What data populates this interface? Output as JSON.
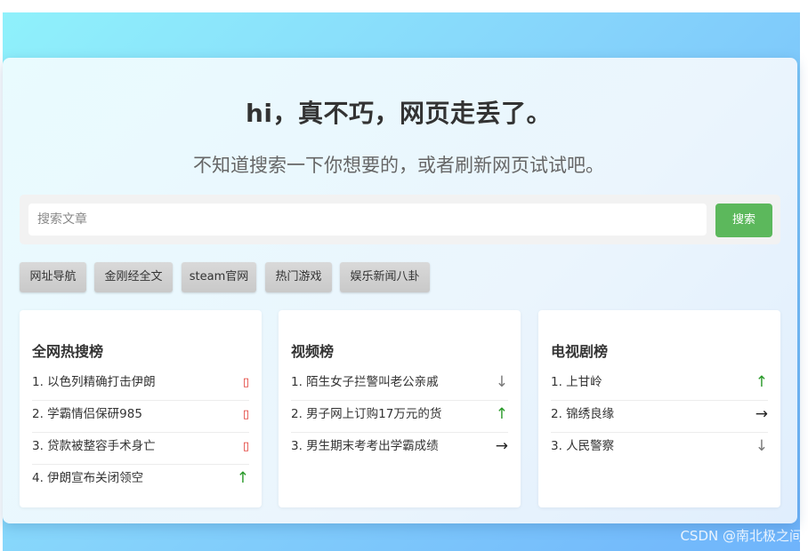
{
  "hero": {
    "title": "hi，真不巧，网页走丢了。",
    "subtitle": "不知道搜索一下你想要的，或者刷新网页试试吧。"
  },
  "search": {
    "placeholder": "搜索文章",
    "button_label": "搜索"
  },
  "tags": [
    {
      "label": "网址导航"
    },
    {
      "label": "金刚经全文"
    },
    {
      "label": "steam官网"
    },
    {
      "label": "热门游戏"
    },
    {
      "label": "娱乐新闻八卦"
    }
  ],
  "panels": [
    {
      "title": "全网热搜榜",
      "items": [
        {
          "text": "1. 以色列精确打击伊朗",
          "trend": "hot",
          "icon": "hot-icon"
        },
        {
          "text": "2. 学霸情侣保研985",
          "trend": "hot",
          "icon": "hot-icon"
        },
        {
          "text": "3. 贷款被整容手术身亡",
          "trend": "hot",
          "icon": "hot-icon"
        },
        {
          "text": "4. 伊朗宣布关闭领空",
          "trend": "up",
          "icon": "arrow-up-icon"
        }
      ]
    },
    {
      "title": "视频榜",
      "items": [
        {
          "text": "1. 陌生女子拦警叫老公亲戚",
          "trend": "down",
          "icon": "arrow-down-icon"
        },
        {
          "text": "2. 男子网上订购17万元的货",
          "trend": "up",
          "icon": "arrow-up-icon"
        },
        {
          "text": "3. 男生期末考考出学霸成绩",
          "trend": "flat",
          "icon": "arrow-right-icon"
        }
      ]
    },
    {
      "title": "电视剧榜",
      "items": [
        {
          "text": "1. 上甘岭",
          "trend": "up",
          "icon": "arrow-up-icon"
        },
        {
          "text": "2. 锦绣良缘",
          "trend": "flat",
          "icon": "arrow-right-icon"
        },
        {
          "text": "3. 人民警察",
          "trend": "down",
          "icon": "arrow-down-icon"
        }
      ]
    }
  ],
  "trend_glyphs": {
    "hot": "▯",
    "up": "↑",
    "down": "↓",
    "flat": "→"
  },
  "watermark": "CSDN @南北极之间",
  "colors": {
    "search_button": "#5cb85c",
    "trend_up": "#2a9a2a",
    "trend_hot": "#e0312a"
  }
}
